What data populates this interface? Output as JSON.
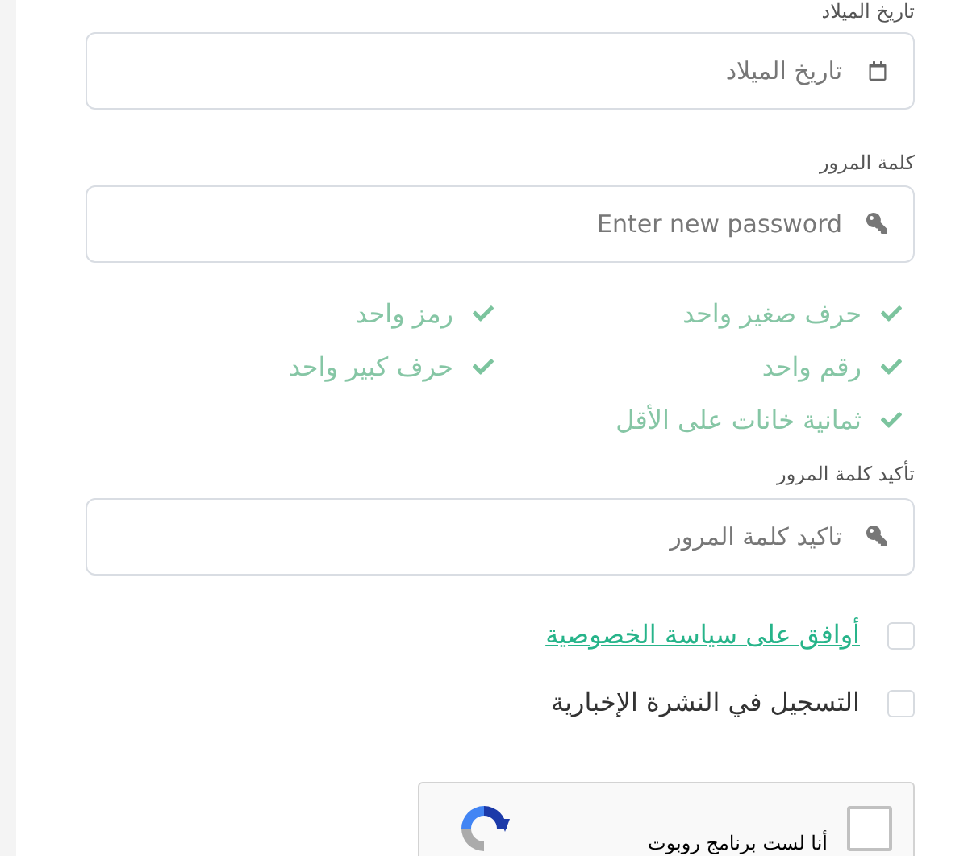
{
  "birth_date": {
    "label": "تاريخ الميلاد",
    "placeholder": "تاريخ الميلاد"
  },
  "password": {
    "label": "كلمة المرور",
    "placeholder": "Enter new password"
  },
  "requirements": [
    {
      "text": "حرف صغير واحد",
      "met": true
    },
    {
      "text": "رمز واحد",
      "met": true
    },
    {
      "text": "رقم واحد",
      "met": true
    },
    {
      "text": "حرف كبير واحد",
      "met": true
    },
    {
      "text": "ثمانية خانات على الأقل",
      "met": true
    }
  ],
  "confirm_password": {
    "label": "تأكيد كلمة المرور",
    "placeholder": "تاكيد كلمة المرور"
  },
  "checkboxes": [
    {
      "kind": "link",
      "label": "أوافق على سياسة الخصوصية",
      "checked": false
    },
    {
      "kind": "text",
      "label": "التسجيل في النشرة الإخبارية",
      "checked": false
    }
  ],
  "captcha": {
    "label": "أنا لست برنامج روبوت",
    "checked": false
  }
}
